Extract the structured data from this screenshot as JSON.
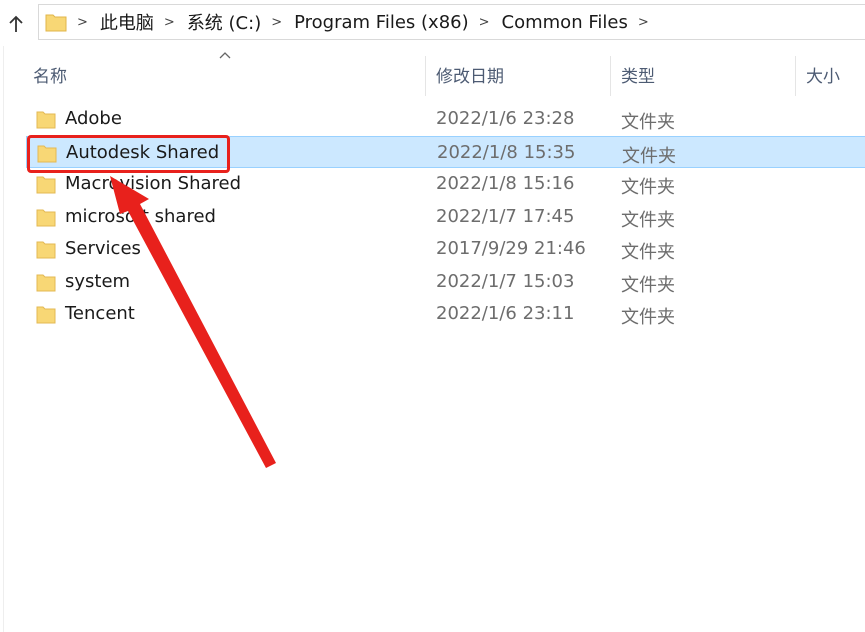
{
  "address_bar": {
    "crumbs": [
      "此电脑",
      "系统 (C:)",
      "Program Files (x86)",
      "Common Files"
    ]
  },
  "columns": {
    "name": "名称",
    "date": "修改日期",
    "type": "类型",
    "size": "大小"
  },
  "rows": [
    {
      "name": "Adobe",
      "date": "2022/1/6 23:28",
      "type": "文件夹"
    },
    {
      "name": "Autodesk Shared",
      "date": "2022/1/8 15:35",
      "type": "文件夹",
      "selected": true
    },
    {
      "name": "Macrovision Shared",
      "date": "2022/1/8 15:16",
      "type": "文件夹"
    },
    {
      "name": "microsoft shared",
      "date": "2022/1/7 17:45",
      "type": "文件夹"
    },
    {
      "name": "Services",
      "date": "2017/9/29 21:46",
      "type": "文件夹"
    },
    {
      "name": "system",
      "date": "2022/1/7 15:03",
      "type": "文件夹"
    },
    {
      "name": "Tencent",
      "date": "2022/1/6 23:11",
      "type": "文件夹"
    }
  ],
  "colors": {
    "selection_bg": "#cce8ff",
    "selection_border": "#99d1ff",
    "annotation": "#e8211c",
    "folder": "#f8d775"
  },
  "icons": [
    "up-arrow-icon",
    "folder-icon",
    "chevron-right-icon",
    "sort-up-icon"
  ]
}
